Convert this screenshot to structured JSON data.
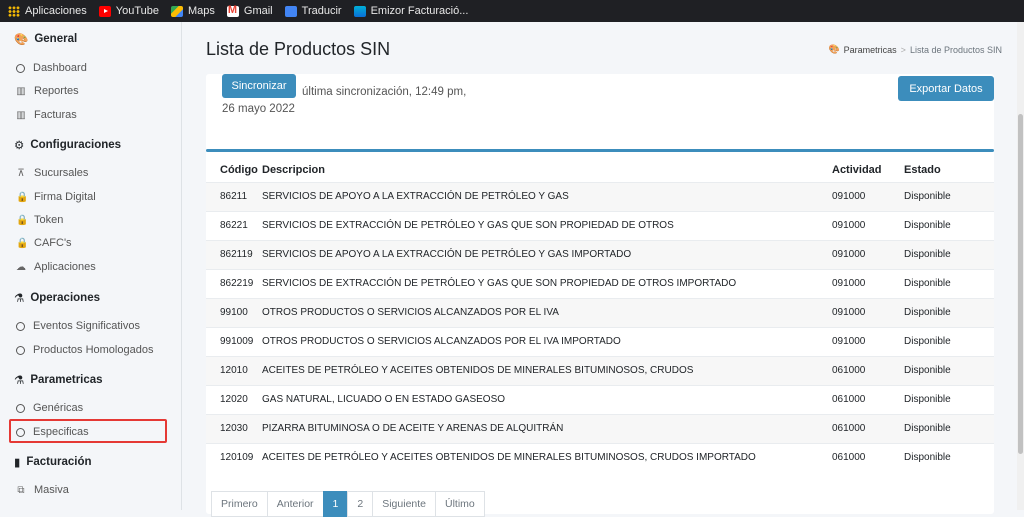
{
  "bookmarks": [
    {
      "label": "Aplicaciones",
      "icon": "apps-grid-icon"
    },
    {
      "label": "YouTube",
      "icon": "youtube-icon"
    },
    {
      "label": "Maps",
      "icon": "maps-icon"
    },
    {
      "label": "Gmail",
      "icon": "gmail-icon"
    },
    {
      "label": "Traducir",
      "icon": "translate-icon"
    },
    {
      "label": "Emizor Facturació...",
      "icon": "emizor-icon"
    }
  ],
  "sidebar": {
    "general": {
      "title": "General",
      "icon": "palette-icon",
      "items": [
        {
          "label": "Dashboard",
          "icon": "circle-icon"
        },
        {
          "label": "Reportes",
          "icon": "bar-chart-icon"
        },
        {
          "label": "Facturas",
          "icon": "bar-chart-icon"
        }
      ]
    },
    "configuraciones": {
      "title": "Configuraciones",
      "icon": "cogs-icon",
      "items": [
        {
          "label": "Sucursales",
          "icon": "sitemap-icon"
        },
        {
          "label": "Firma Digital",
          "icon": "lock-icon"
        },
        {
          "label": "Token",
          "icon": "lock-icon"
        },
        {
          "label": "CAFC's",
          "icon": "lock-icon"
        },
        {
          "label": "Aplicaciones",
          "icon": "cloud-icon"
        }
      ]
    },
    "operaciones": {
      "title": "Operaciones",
      "icon": "flask-icon",
      "items": [
        {
          "label": "Eventos Significativos",
          "icon": "circle-icon"
        },
        {
          "label": "Productos Homologados",
          "icon": "circle-icon"
        }
      ]
    },
    "parametricas": {
      "title": "Parametricas",
      "icon": "flask-icon",
      "items": [
        {
          "label": "Genéricas",
          "icon": "circle-icon"
        },
        {
          "label": "Especificas",
          "icon": "circle-icon"
        }
      ]
    },
    "facturacion": {
      "title": "Facturación",
      "icon": "file-icon",
      "items": [
        {
          "label": "Masiva",
          "icon": "copy-icon"
        }
      ]
    }
  },
  "header": {
    "title": "Lista de Productos SIN",
    "breadcrumb": [
      "Parametricas",
      "Lista de Productos SIN"
    ]
  },
  "toolbar": {
    "sync_label": "Sincronizar",
    "sync_text": "última sincronización, 12:49 pm, 26 mayo 2022",
    "export_label": "Exportar Datos"
  },
  "table": {
    "headers": [
      "Código",
      "Descripcion",
      "Actividad",
      "Estado"
    ],
    "rows": [
      [
        "86211",
        "SERVICIOS DE APOYO A LA EXTRACCIÓN DE PETRÓLEO Y GAS",
        "091000",
        "Disponible"
      ],
      [
        "86221",
        "SERVICIOS DE EXTRACCIÓN DE PETRÓLEO Y GAS QUE SON PROPIEDAD DE OTROS",
        "091000",
        "Disponible"
      ],
      [
        "862119",
        "SERVICIOS DE APOYO A LA EXTRACCIÓN DE PETRÓLEO Y GAS IMPORTADO",
        "091000",
        "Disponible"
      ],
      [
        "862219",
        "SERVICIOS DE EXTRACCIÓN DE PETRÓLEO Y GAS QUE SON PROPIEDAD DE OTROS IMPORTADO",
        "091000",
        "Disponible"
      ],
      [
        "99100",
        "OTROS PRODUCTOS O SERVICIOS ALCANZADOS POR EL IVA",
        "091000",
        "Disponible"
      ],
      [
        "991009",
        "OTROS PRODUCTOS O SERVICIOS ALCANZADOS POR EL IVA IMPORTADO",
        "091000",
        "Disponible"
      ],
      [
        "12010",
        "ACEITES DE PETRÓLEO Y ACEITES OBTENIDOS DE MINERALES BITUMINOSOS, CRUDOS",
        "061000",
        "Disponible"
      ],
      [
        "12020",
        "GAS NATURAL, LICUADO O EN ESTADO GASEOSO",
        "061000",
        "Disponible"
      ],
      [
        "12030",
        "PIZARRA BITUMINOSA O DE ACEITE Y ARENAS DE ALQUITRÁN",
        "061000",
        "Disponible"
      ],
      [
        "120109",
        "ACEITES DE PETRÓLEO Y ACEITES OBTENIDOS DE MINERALES BITUMINOSOS, CRUDOS IMPORTADO",
        "061000",
        "Disponible"
      ]
    ]
  },
  "pagination": [
    "Primero",
    "Anterior",
    "1",
    "2",
    "Siguiente",
    "Último"
  ],
  "colors": {
    "accent": "#3c8dbc",
    "highlight": "#e53935"
  }
}
